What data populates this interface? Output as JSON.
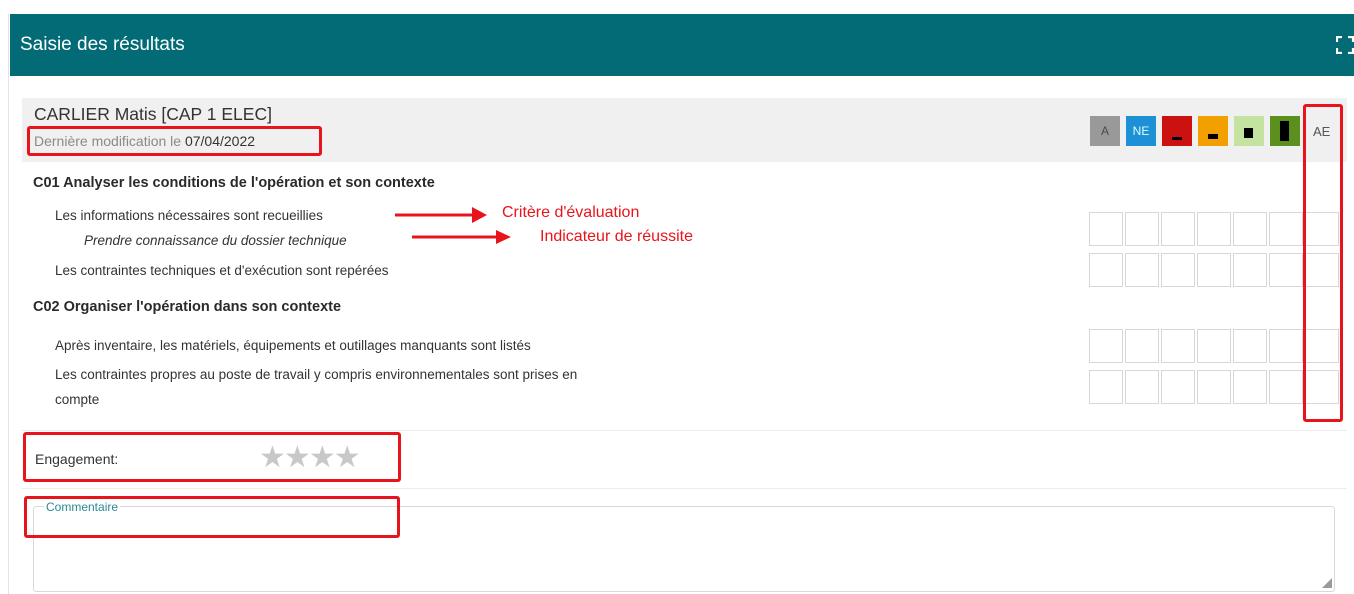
{
  "header": {
    "title": "Saisie des résultats"
  },
  "student": {
    "name": "CARLIER Matis [CAP 1 ELEC]",
    "last_modified_label": "Dernière modification le",
    "last_modified_date": "07/04/2022"
  },
  "levels": [
    {
      "label": "A",
      "color": "#999999"
    },
    {
      "label": "NE",
      "color": "#1e90d6"
    },
    {
      "label": "",
      "color": "#cc1111",
      "icon": "level-bar-low-icon"
    },
    {
      "label": "",
      "color": "#f2a000",
      "icon": "level-bar-medium-low-icon"
    },
    {
      "label": "",
      "color": "#c5e3a0",
      "icon": "level-bar-medium-high-icon"
    },
    {
      "label": "",
      "color": "#5b8f1e",
      "icon": "level-bar-high-icon"
    }
  ],
  "ae_label": "AE",
  "competences": [
    {
      "title": "C01 Analyser les conditions de l'opération et son contexte",
      "criteria": [
        {
          "label": "Les informations nécessaires sont recueillies",
          "indicator": "Prendre connaissance du dossier technique"
        },
        {
          "label": "Les contraintes techniques et d'exécution sont repérées"
        }
      ]
    },
    {
      "title": "C02 Organiser l'opération dans son contexte",
      "criteria": [
        {
          "label": "Après inventaire, les matériels, équipements et outillages manquants sont listés"
        },
        {
          "label_line1": "Les contraintes propres au poste de travail y compris environnementales sont prises en",
          "label_line2": "compte"
        }
      ]
    }
  ],
  "annotations": {
    "criterion": "Critère d'évaluation",
    "indicator": "Indicateur de réussite",
    "color": "#e8141b"
  },
  "engagement": {
    "label": "Engagement:",
    "rating": 0,
    "max": 4
  },
  "comment": {
    "label": "Commentaire",
    "value": ""
  },
  "colors": {
    "header": "#026b75",
    "highlight": "#e8141b"
  }
}
